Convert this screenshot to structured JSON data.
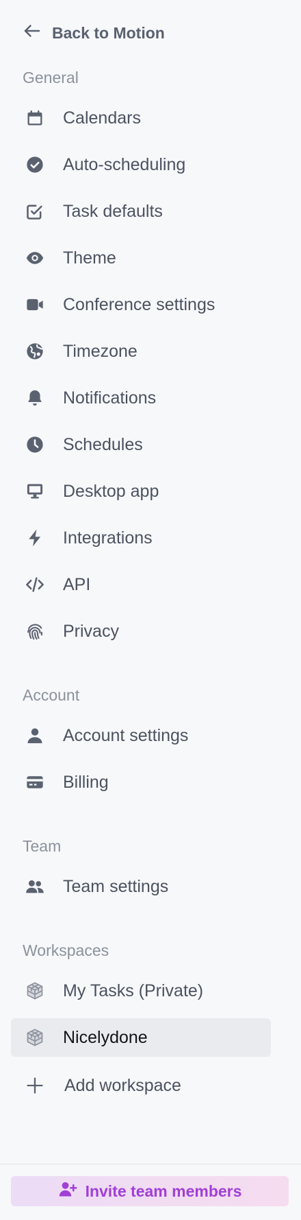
{
  "back": {
    "label": "Back to Motion",
    "icon": "arrow-left-icon"
  },
  "sections": {
    "general": {
      "label": "General",
      "items": [
        {
          "label": "Calendars",
          "icon": "calendar-icon"
        },
        {
          "label": "Auto-scheduling",
          "icon": "check-circle-icon"
        },
        {
          "label": "Task defaults",
          "icon": "checkbox-icon"
        },
        {
          "label": "Theme",
          "icon": "eye-icon"
        },
        {
          "label": "Conference settings",
          "icon": "video-camera-icon"
        },
        {
          "label": "Timezone",
          "icon": "globe-icon"
        },
        {
          "label": "Notifications",
          "icon": "bell-icon"
        },
        {
          "label": "Schedules",
          "icon": "clock-icon"
        },
        {
          "label": "Desktop app",
          "icon": "monitor-icon"
        },
        {
          "label": "Integrations",
          "icon": "lightning-bolt-icon"
        },
        {
          "label": "API",
          "icon": "code-icon"
        },
        {
          "label": "Privacy",
          "icon": "fingerprint-icon"
        }
      ]
    },
    "account": {
      "label": "Account",
      "items": [
        {
          "label": "Account settings",
          "icon": "user-icon"
        },
        {
          "label": "Billing",
          "icon": "credit-card-icon"
        }
      ]
    },
    "team": {
      "label": "Team",
      "items": [
        {
          "label": "Team settings",
          "icon": "users-icon"
        }
      ]
    },
    "workspaces": {
      "label": "Workspaces",
      "items": [
        {
          "label": "My Tasks (Private)",
          "icon": "cube-icon"
        },
        {
          "label": "Nicelydone",
          "icon": "cube-icon",
          "active": true
        }
      ],
      "add_label": "Add workspace"
    }
  },
  "invite": {
    "label": "Invite team members",
    "icon": "user-plus-icon"
  },
  "colors": {
    "background": "#f7f8fa",
    "text": "#4b5360",
    "active_bg": "#e9ebee",
    "accent": "#a13fd6"
  }
}
